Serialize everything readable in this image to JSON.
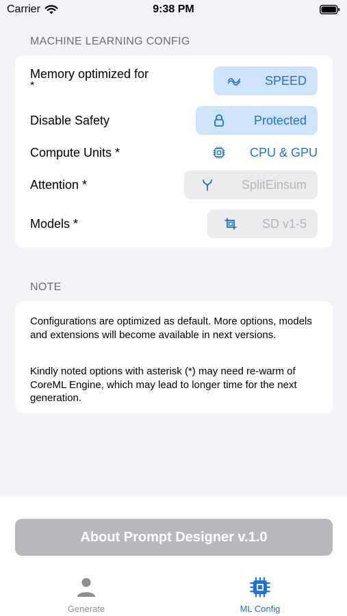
{
  "status_bar": {
    "carrier": "Carrier",
    "time": "9:38 PM"
  },
  "ml_config": {
    "header": "MACHINE LEARNING CONFIG",
    "rows": [
      {
        "label_line1": "Memory optimized for",
        "label_line2": "*",
        "value": "SPEED",
        "icon": "speed-wave-icon"
      },
      {
        "label": "Disable Safety",
        "value": "Protected",
        "icon": "lock-icon"
      },
      {
        "label": "Compute Units *",
        "value": "CPU & GPU",
        "icon": "cpu-chip-icon"
      },
      {
        "label": "Attention *",
        "value": "SplitEinsum",
        "icon": "branch-icon"
      },
      {
        "label": "Models *",
        "value": "SD v1-5",
        "icon": "crop-frame-icon"
      }
    ]
  },
  "note": {
    "header": "NOTE",
    "paragraph1": "Configurations are optimized as default. More options, models and extensions will become available in next versions.",
    "paragraph2": "Kindly noted options with asterisk (*) may need re-warm of CoreML Engine, which may lead to longer time for the next generation."
  },
  "about_button": "About Prompt Designer v.1.0",
  "tabs": [
    {
      "label": "Generate",
      "icon": "person-icon",
      "selected": false
    },
    {
      "label": "ML Config",
      "icon": "cpu-chip-icon",
      "selected": true
    }
  ],
  "colors": {
    "accent": "#1a73d9",
    "pill_blue": "#cfe3fa",
    "pill_gray": "#ececee",
    "background": "#f2f2f7",
    "disabled_button": "#b9b9bd"
  }
}
